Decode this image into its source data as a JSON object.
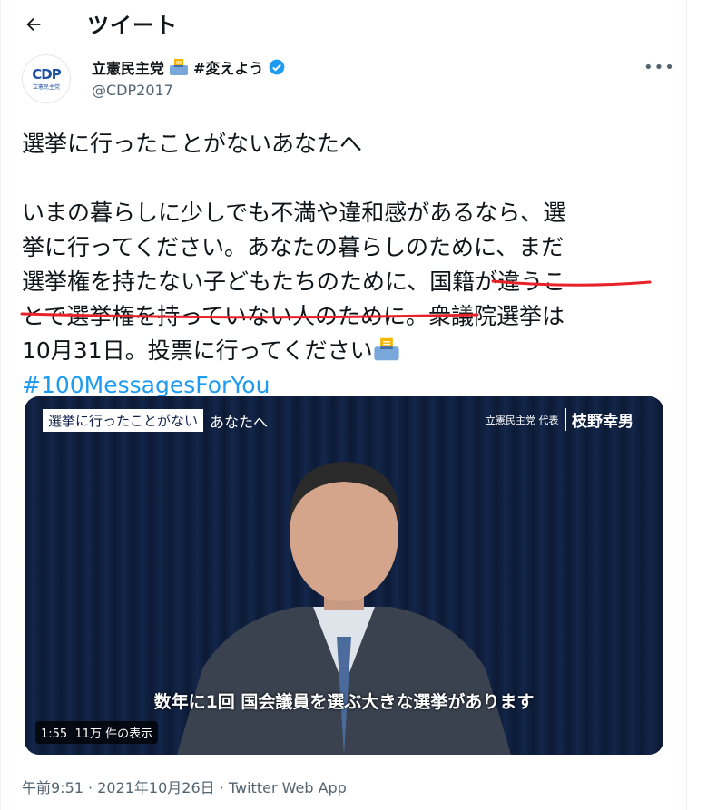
{
  "header": {
    "title": "ツイート"
  },
  "account": {
    "name": "立憲民主党",
    "hashtag_name": "#変えよう",
    "handle": "@CDP2017",
    "logo_text": "CDP",
    "logo_sub": "立憲民主党"
  },
  "tweet": {
    "lines": [
      "選挙に行ったことがないあなたへ"
    ],
    "para2": [
      "いまの暮らしに少しでも不満や違和感があるなら、選",
      "挙に行ってください。あなたの暮らしのために、まだ",
      "選挙権を持たない子どもたちのために、国籍が違うこ",
      "とで選挙権を持っていない人のために。衆議院選挙は",
      "10月31日。投票に行ってください"
    ],
    "hashtag": "#100MessagesForYou"
  },
  "video": {
    "title_box": "選挙に行ったことがない",
    "title_rest": "あなたへ",
    "party_label": "立憲民主党 代表",
    "speaker": "枝野幸男",
    "subtitle": "数年に1回 国会議員を選ぶ大きな選挙があります",
    "duration": "1:55",
    "views": "11万 件の表示"
  },
  "footer": {
    "time": "午前9:51 · 2021年10月26日 · ",
    "source": "Twitter Web App"
  },
  "colors": {
    "link": "#1d9bf0",
    "annotation": "#e8222a",
    "verified": "#1d9bf0"
  }
}
